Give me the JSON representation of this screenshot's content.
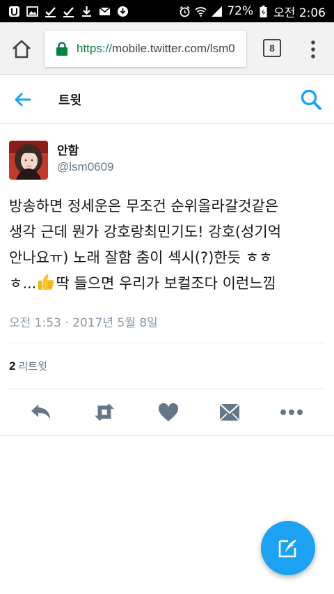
{
  "status_bar": {
    "battery": "72%",
    "time": "오전 2:06"
  },
  "browser": {
    "url_scheme": "https://",
    "url_rest": "mobile.twitter.com/lsm0",
    "tab_count": "8"
  },
  "header": {
    "title": "트윗"
  },
  "tweet": {
    "display_name": "안함",
    "username": "@lsm0609",
    "lines": [
      "방송하면 정세운은 무조건 순위올라갈것같은",
      "생각 근데 뭔가 강호랑최민기도! 강호(성기억",
      "안나요ㅠ) 노래 잘함 춤이 섹시(?)한듯 ㅎㅎ",
      "ㅎ...",
      "딱 들으면 우리가 보컬조다 이런느낌"
    ],
    "timestamp": "오전 1:53 · 2017년 5월 8일",
    "retweet_count": "2",
    "retweet_label": "리트윗"
  },
  "colors": {
    "accent": "#1da1f2",
    "action_icon": "#657786",
    "text": "#14171a"
  },
  "icons": {
    "home": "home-icon",
    "lock": "lock-icon",
    "back": "back-arrow-icon",
    "search": "search-icon",
    "reply": "reply-icon",
    "retweet": "retweet-icon",
    "like": "heart-icon",
    "dm": "envelope-icon",
    "more": "more-icon",
    "compose": "compose-icon"
  }
}
